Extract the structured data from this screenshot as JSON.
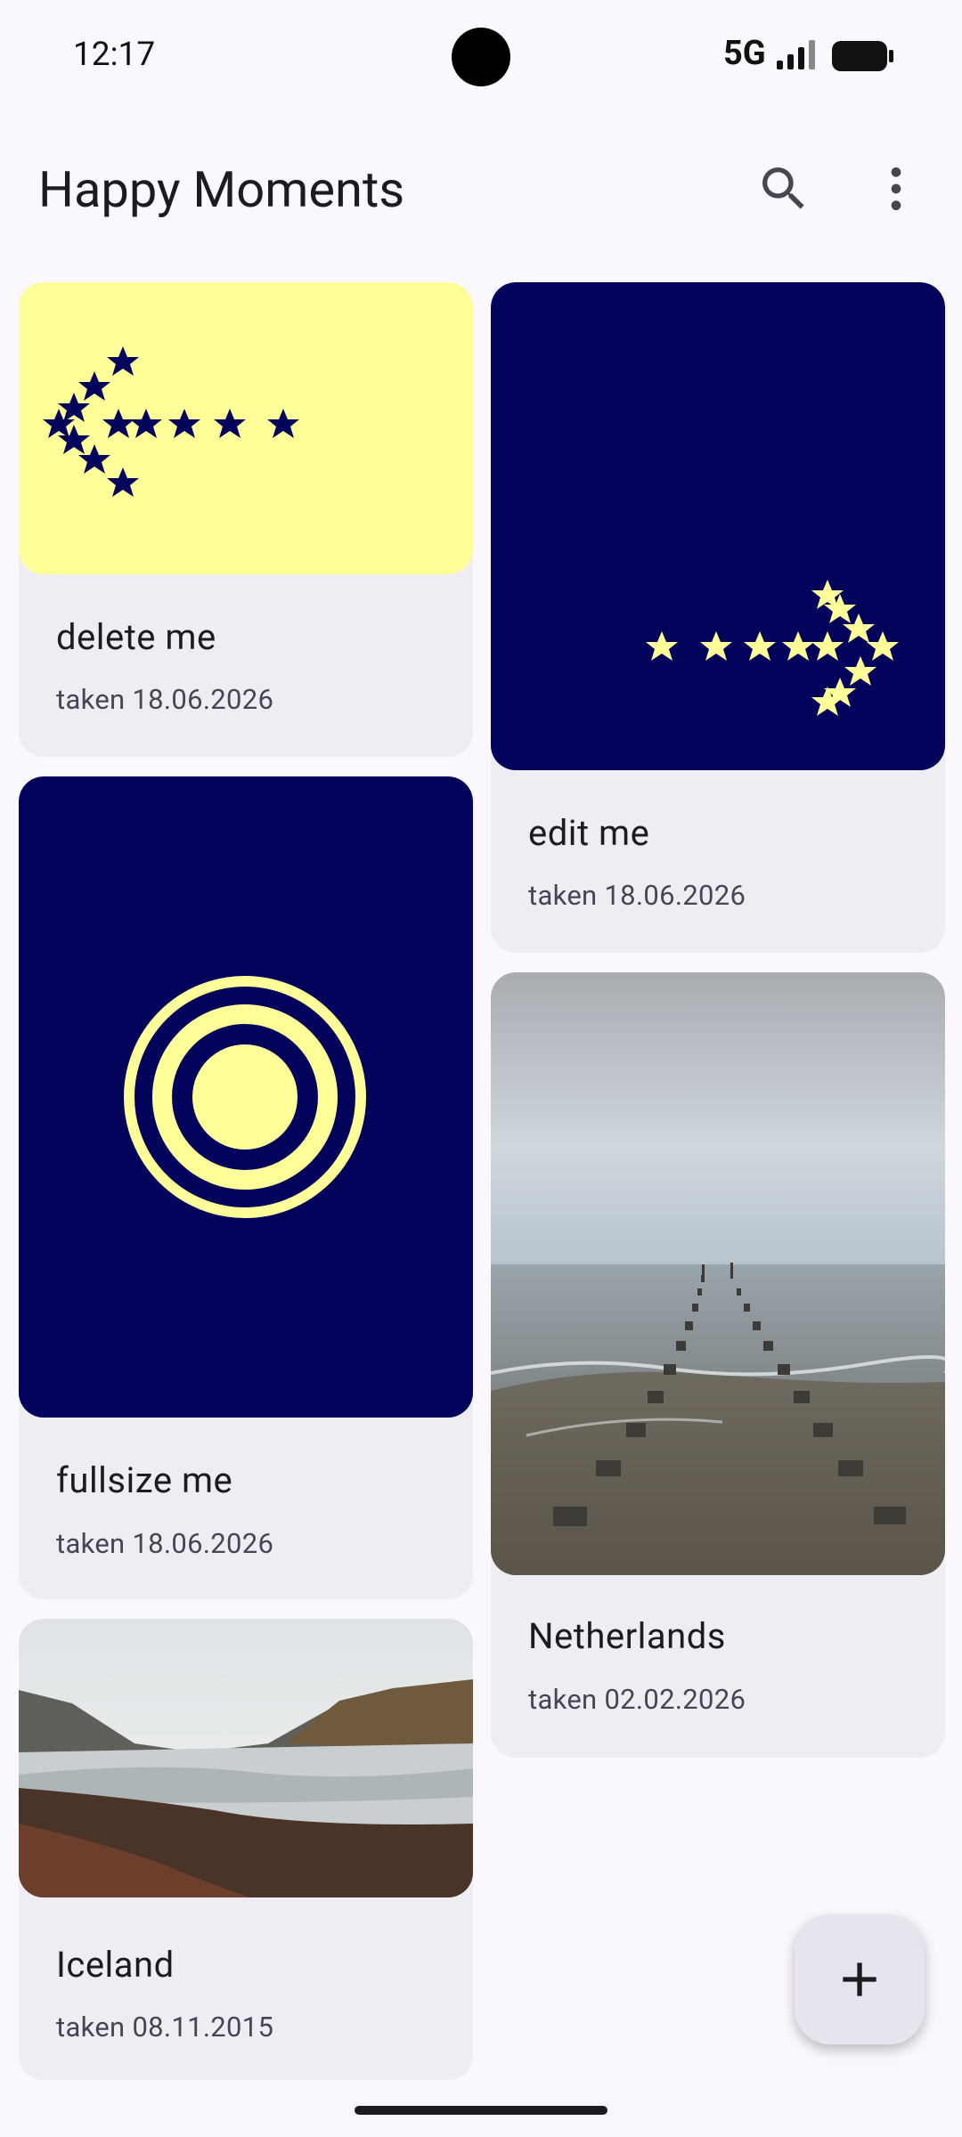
{
  "status": {
    "time": "12:17",
    "network": "5G"
  },
  "appbar": {
    "title": "Happy Moments",
    "search_icon": "search-icon",
    "menu_icon": "more-vert-icon"
  },
  "cards": [
    {
      "title": "delete me",
      "date": "taken 18.06.2026",
      "art": "yellow-stars-arrow-left"
    },
    {
      "title": "edit me",
      "date": "taken 18.06.2026",
      "art": "navy-stars-arrow-right"
    },
    {
      "title": "fullsize me",
      "date": "taken 18.06.2026",
      "art": "concentric-circles"
    },
    {
      "title": "Netherlands",
      "date": "taken 02.02.2026",
      "art": "beach-photo"
    },
    {
      "title": "Iceland",
      "date": "taken 08.11.2015",
      "art": "glacier-photo"
    }
  ],
  "fab": {
    "icon": "add-icon"
  },
  "colors": {
    "navy": "#03035c",
    "yellow": "#ffff99",
    "card_bg": "#efedf4",
    "background": "#fbf8fd"
  }
}
